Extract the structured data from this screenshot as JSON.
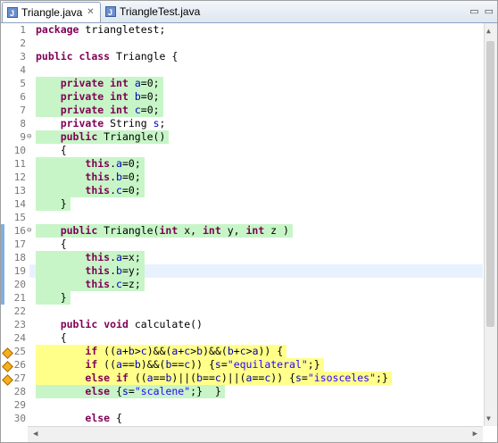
{
  "tabs": [
    {
      "label": "Triangle.java",
      "active": true,
      "close": "✕"
    },
    {
      "label": "TriangleTest.java",
      "active": false
    }
  ],
  "window_buttons": {
    "minimize": "▭",
    "maximize": "▭"
  },
  "editor": {
    "lines": [
      {
        "n": "1",
        "t": "package triangletest;"
      },
      {
        "n": "2",
        "t": ""
      },
      {
        "n": "3",
        "t": "public class Triangle {"
      },
      {
        "n": "4",
        "t": ""
      },
      {
        "n": "5",
        "t": "    private int a=0;"
      },
      {
        "n": "6",
        "t": "    private int b=0;"
      },
      {
        "n": "7",
        "t": "    private int c=0;"
      },
      {
        "n": "8",
        "t": "    private String s;"
      },
      {
        "n": "9",
        "t": "    public Triangle()"
      },
      {
        "n": "10",
        "t": "    {"
      },
      {
        "n": "11",
        "t": "        this.a=0;"
      },
      {
        "n": "12",
        "t": "        this.b=0;"
      },
      {
        "n": "13",
        "t": "        this.c=0;"
      },
      {
        "n": "14",
        "t": "    }"
      },
      {
        "n": "15",
        "t": ""
      },
      {
        "n": "16",
        "t": "    public Triangle(int x, int y, int z )"
      },
      {
        "n": "17",
        "t": "    {"
      },
      {
        "n": "18",
        "t": "        this.a=x;"
      },
      {
        "n": "19",
        "t": "        this.b=y;"
      },
      {
        "n": "20",
        "t": "        this.c=z;"
      },
      {
        "n": "21",
        "t": "    }"
      },
      {
        "n": "22",
        "t": ""
      },
      {
        "n": "23",
        "t": "    public void calculate()"
      },
      {
        "n": "24",
        "t": "    {"
      },
      {
        "n": "25",
        "t": "        if ((a+b>c)&&(a+c>b)&&(b+c>a)) {"
      },
      {
        "n": "26",
        "t": "        if ((a==b)&&(b==c)) {s=\"equilateral\";}"
      },
      {
        "n": "27",
        "t": "        else if ((a==b)||(b==c)||(a==c)) {s=\"isosceles\";}"
      },
      {
        "n": "28",
        "t": "        else {s=\"scalene\";}  }"
      },
      {
        "n": "29",
        "t": ""
      },
      {
        "n": "30",
        "t": "        else {"
      }
    ]
  },
  "colors": {
    "covered": "#c7f5c7",
    "partial": "#ffff8a",
    "keyword": "#7f0055",
    "field": "#0000c0",
    "string": "#2a00ff"
  }
}
